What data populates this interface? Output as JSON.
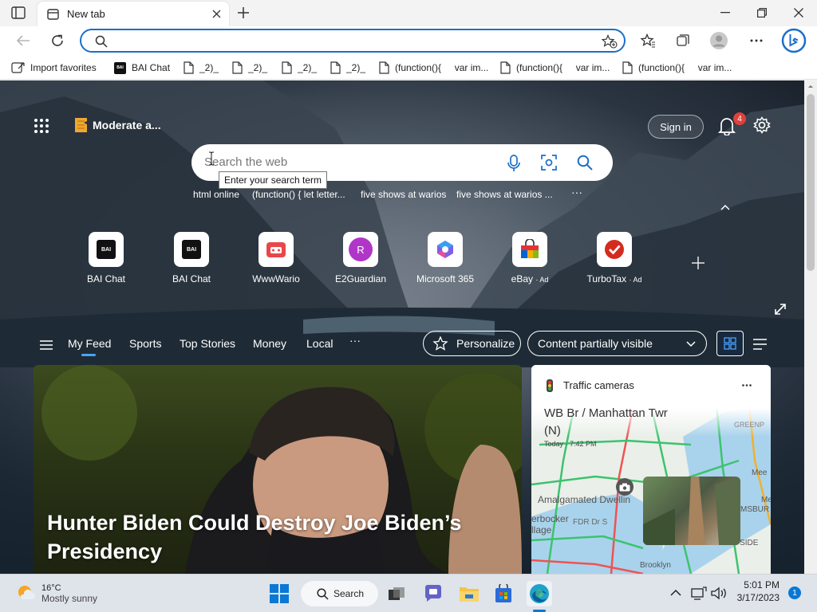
{
  "browser": {
    "tab_title": "New tab",
    "address_value": "",
    "favorites": [
      {
        "label": "Import favorites",
        "icon": "import-icon"
      },
      {
        "label": "BAI Chat",
        "icon": "bai-icon"
      },
      {
        "label": "_2)_",
        "icon": "page-icon"
      },
      {
        "label": "_2)_",
        "icon": "page-icon"
      },
      {
        "label": "_2)_",
        "icon": "page-icon"
      },
      {
        "label": "_2)_",
        "icon": "page-icon"
      },
      {
        "label": "(function(){     var im...",
        "icon": "page-icon"
      },
      {
        "label": "(function(){     var im...",
        "icon": "page-icon"
      },
      {
        "label": "(function(){     var im...",
        "icon": "page-icon"
      }
    ]
  },
  "newtab": {
    "safesearch_label": "Moderate a...",
    "sign_in": "Sign in",
    "notification_count": "4",
    "search_placeholder": "Search the web",
    "search_tooltip": "Enter your search term",
    "suggestions": [
      "html online",
      "(function() { let letter...",
      "five shows at warios",
      "five shows at warios ..."
    ],
    "more_glyph": "···",
    "quicklinks": [
      {
        "label": "BAI Chat",
        "ad": ""
      },
      {
        "label": "BAI Chat",
        "ad": ""
      },
      {
        "label": "WwwWario",
        "ad": ""
      },
      {
        "label": "E2Guardian",
        "ad": "",
        "letter": "R"
      },
      {
        "label": "Microsoft 365",
        "ad": ""
      },
      {
        "label": "eBay",
        "ad": "· Ad"
      },
      {
        "label": "TurboTax",
        "ad": "· Ad"
      }
    ],
    "feed_tabs": [
      "My Feed",
      "Sports",
      "Top Stories",
      "Money",
      "Local"
    ],
    "active_tab": "My Feed",
    "personalize": "Personalize",
    "content_visibility": "Content partially visible",
    "headline": "Hunter Biden Could Destroy Joe Biden’s Presidency",
    "traffic": {
      "title": "Traffic cameras",
      "camera": "WB Br / Manhattan Twr (N)",
      "time": "Today · 7:42 PM",
      "map_labels": [
        "Amalgamated Dwellin",
        "erbocker",
        "llage",
        "FDR Dr S",
        "GREENP",
        "Brooklyn",
        "JTH SIDE",
        "MSBUR",
        "Mee",
        "Me"
      ]
    }
  },
  "taskbar": {
    "temp": "16°C",
    "weather": "Mostly sunny",
    "search": "Search",
    "time": "5:01 PM",
    "date": "3/17/2023",
    "notif_count": "1"
  },
  "colors": {
    "accent": "#1b6fc8",
    "edge_blue": "#0c59a4"
  }
}
